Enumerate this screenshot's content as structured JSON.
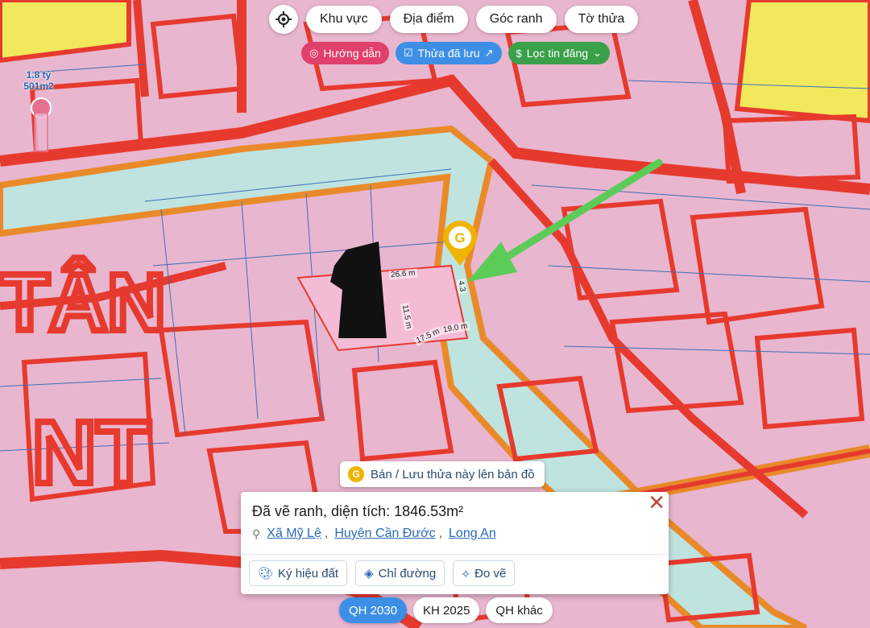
{
  "top_nav": {
    "tabs": [
      "Khu vực",
      "Địa điểm",
      "Góc ranh",
      "Tờ thửa"
    ]
  },
  "actions": {
    "directions": "Hướng dẫn",
    "saved": "Thửa đã lưu",
    "filter": "Lọc tin đăng"
  },
  "price_tag": {
    "price": "1.8 tỷ",
    "area": "501m2"
  },
  "map_labels": {
    "edge_top": "26.6 m",
    "edge_left": "11.5 m",
    "edge_bottom_a": "17.5 m",
    "edge_bottom_b": "19.0 m",
    "edge_right": "4.3"
  },
  "save_button": "Bán / Lưu thửa này lên bản đồ",
  "info_card": {
    "title": "Đã vẽ ranh, diện tích: 1846.53m²",
    "location": {
      "commune": "Xã Mỹ Lệ",
      "district": "Huyện Cần Đước",
      "province": "Long An"
    },
    "buttons": [
      "Ký hiệu đất",
      "Chỉ đường",
      "Đo vẽ"
    ]
  },
  "layers": [
    "QH 2030",
    "KH 2025",
    "QH khác"
  ],
  "colors": {
    "land_pink": "#e9b6cf",
    "plan_red": "#e63a2e",
    "river": "#bfe3df",
    "road_orange": "#e98a2a",
    "yellow_zone": "#f2e85c",
    "arrow_green": "#5ccc58",
    "marker_gold": "#f0b400"
  }
}
